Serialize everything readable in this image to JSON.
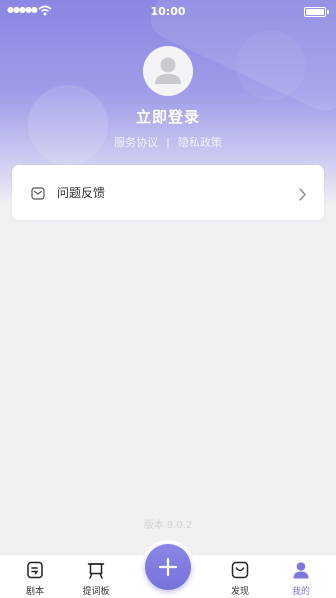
{
  "status_bar": {
    "signal": "●●●●●",
    "time": "10:00"
  },
  "profile": {
    "login_label": "立即登录",
    "service_agreement": "服务协议",
    "separator": "|",
    "privacy_policy": "隐私政策"
  },
  "menu": {
    "items": [
      {
        "label": "问题反馈",
        "icon": "mail-icon"
      }
    ]
  },
  "footer": {
    "version": "版本 8.0.2"
  },
  "tabbar": {
    "items": [
      {
        "label": "剧本",
        "icon": "script-icon",
        "active": false
      },
      {
        "label": "提词板",
        "icon": "teleprompter-icon",
        "active": false
      },
      {
        "label": "",
        "icon": "plus-icon",
        "active": false
      },
      {
        "label": "发现",
        "icon": "discover-icon",
        "active": false
      },
      {
        "label": "我的",
        "icon": "user-icon",
        "active": true
      }
    ]
  },
  "colors": {
    "accent": "#7c78dd",
    "header_top": "#8a86e3",
    "background": "#f0f0f3"
  }
}
